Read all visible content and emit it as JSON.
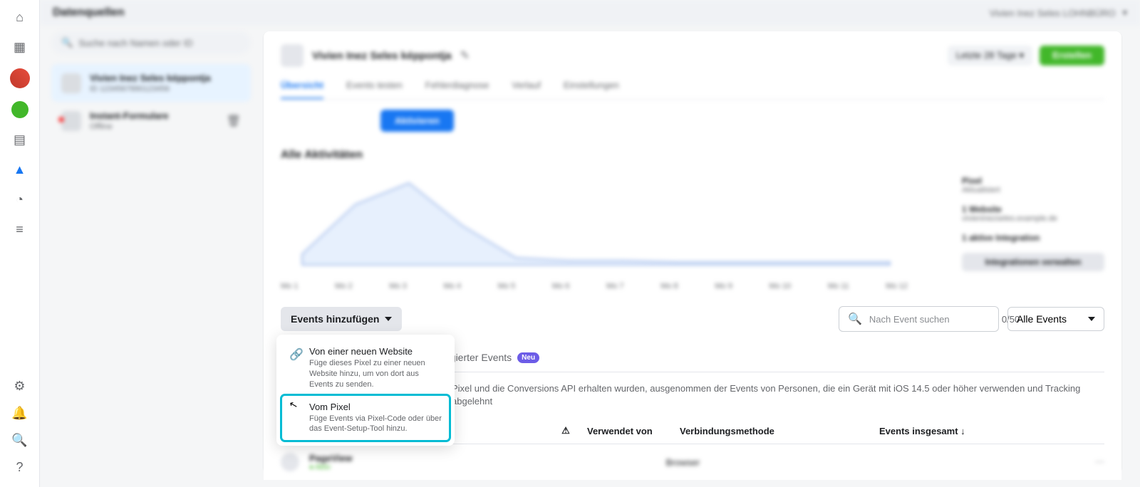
{
  "topbar": {
    "title": "Datenquellen",
    "account": "Vivien Inez Seles LOHNBÜRO"
  },
  "sidebar": {
    "search_placeholder": "Suche nach Namen oder ID",
    "items": [
      {
        "title": "Vivien Inez Seles képpontja",
        "sub": "ID 1234567890123456"
      },
      {
        "title": "Instant-Formulare",
        "sub": "Offline"
      }
    ]
  },
  "header": {
    "title": "Vivien Inez Seles képpontja",
    "date_range": "Letzte 28 Tage",
    "create": "Erstellen",
    "tabs": [
      "Übersicht",
      "Events testen",
      "Fehlerdiagnose",
      "Verlauf",
      "Einstellungen"
    ]
  },
  "body": {
    "button": "Aktivieren",
    "section_title": "Alle Aktivitäten"
  },
  "info_cards": {
    "pixel": {
      "title": "Pixel",
      "sub": "Aktualisiert"
    },
    "website": {
      "title": "1 Website",
      "sub": "vivieninezseles.example.de"
    },
    "integration": {
      "title": "1 aktive Integration"
    },
    "manage": "Integrationen verwalten"
  },
  "chart_data": {
    "type": "area",
    "x_labels": [
      "Mo 1",
      "Mo 2",
      "Mo 3",
      "Mo 4",
      "Mo 5",
      "Mo 6",
      "Mo 7",
      "Mo 8",
      "Mo 9",
      "Mo 10",
      "Mo 11",
      "Mo 12"
    ],
    "values": [
      5,
      28,
      42,
      18,
      6,
      4,
      4,
      3,
      3,
      3,
      3,
      3
    ],
    "ylim": [
      0,
      50
    ]
  },
  "toolbar": {
    "add_events": "Events hinzufügen",
    "search_placeholder": "Nach Event suchen",
    "search_count": "0/50",
    "all_events": "Alle Events"
  },
  "dropdown": [
    {
      "icon": "link",
      "title": "Von einer neuen Website",
      "desc": "Füge dieses Pixel zu einer neuen Website hinzu, um von dort aus Events zu senden."
    },
    {
      "icon": "pixel",
      "title": "Vom Pixel",
      "desc": "Füge Events via Pixel-Code oder über das Event-Setup-Tool hinzu."
    }
  ],
  "subtabs": {
    "partial": "egierter Events",
    "badge": "Neu"
  },
  "description": "Pixel und die Conversions API erhalten wurden, ausgenommen der Events von Personen, die ein Gerät mit iOS 14.5 oder höher verwenden und Tracking abgelehnt",
  "table": {
    "headers": {
      "warn": "⚠",
      "used_by": "Verwendet von",
      "method": "Verbindungsmethode",
      "total": "Events insgesamt ↓"
    },
    "rows": [
      {
        "name": "PageView",
        "status": "Aktiv",
        "method": "Browser",
        "total": ""
      }
    ]
  }
}
